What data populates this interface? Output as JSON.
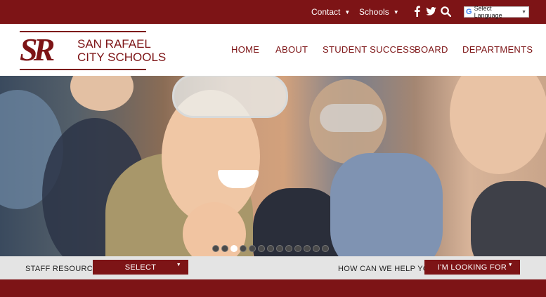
{
  "topbar": {
    "contact_label": "Contact",
    "schools_label": "Schools",
    "chevron_glyph": "⌄",
    "language_label": "Select Language",
    "google_glyph": "G",
    "colors": {
      "background": "#7d1416",
      "text": "#ffffff"
    }
  },
  "logo": {
    "monogram": "SR",
    "line1": "SAN RAFAEL",
    "line2": "CITY SCHOOLS"
  },
  "nav": {
    "items": [
      "HOME",
      "ABOUT",
      "STUDENT SUCCESS",
      "BOARD",
      "DEPARTMENTS"
    ]
  },
  "hero": {
    "slide_count": 13,
    "active_slide": 3
  },
  "strip": {
    "staff_label": "STAFF RESOURCES:",
    "select_label": "SELECT",
    "help_label": "HOW CAN WE HELP YOU:",
    "looking_label": "I'M LOOKING FOR"
  },
  "colors": {
    "brand": "#7d1416",
    "strip_bg": "#e4e4e4"
  }
}
